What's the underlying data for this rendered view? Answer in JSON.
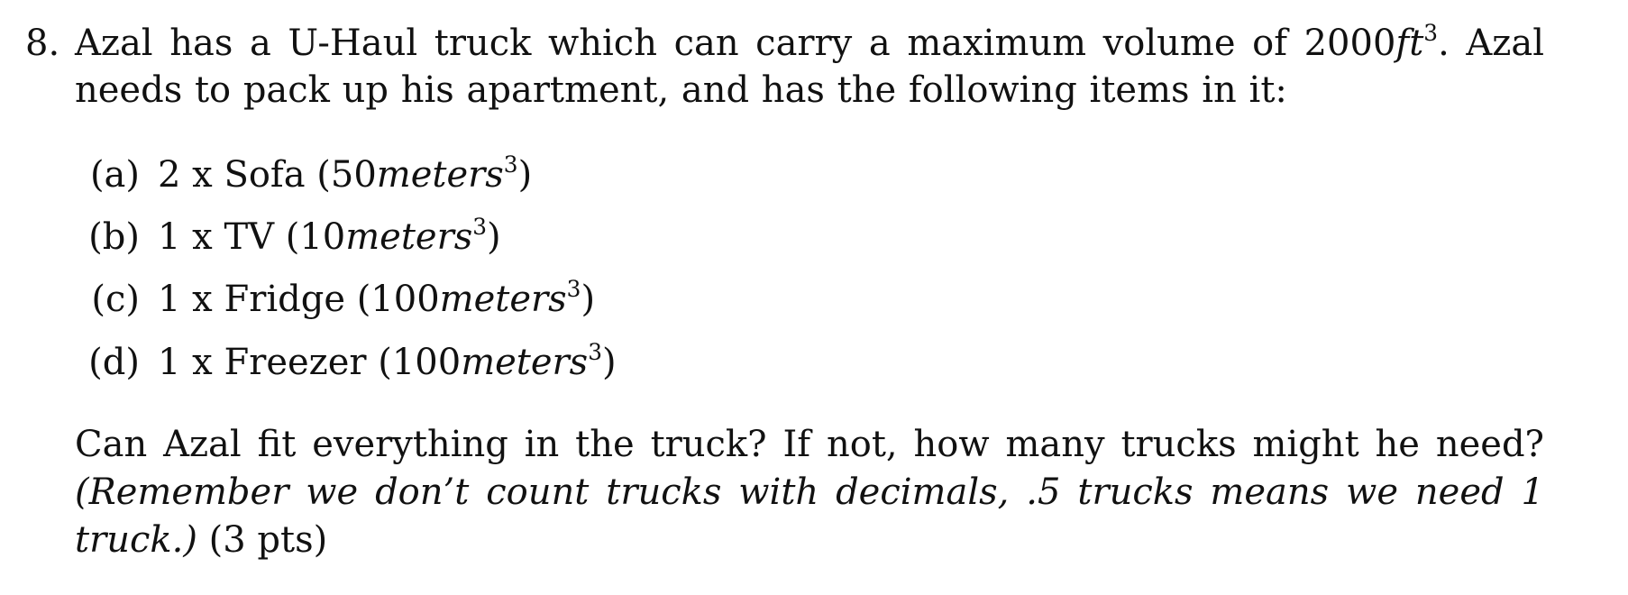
{
  "problem": {
    "number": "8.",
    "stem_part1": "Azal has a U-Haul truck which can carry a maximum volume of 2000",
    "stem_unit": "ft",
    "stem_unit_exp": "3",
    "stem_part2": ". Azal needs to pack up his apartment, and has the following items in it:",
    "items": [
      {
        "label": "(a)",
        "text": "2 x Sofa (50",
        "unit": "meters",
        "exp": "3",
        "close": ")"
      },
      {
        "label": "(b)",
        "text": "1 x TV (10",
        "unit": "meters",
        "exp": "3",
        "close": ")"
      },
      {
        "label": "(c)",
        "text": "1 x Fridge (100",
        "unit": "meters",
        "exp": "3",
        "close": ")"
      },
      {
        "label": "(d)",
        "text": "1 x Freezer (100",
        "unit": "meters",
        "exp": "3",
        "close": ")"
      }
    ],
    "question": "Can Azal fit everything in the truck? If not, how many trucks might he need?",
    "note": "(Remember we don’t count trucks with decimals, .5 trucks means we need 1 truck.)",
    "points": "(3 pts)"
  }
}
